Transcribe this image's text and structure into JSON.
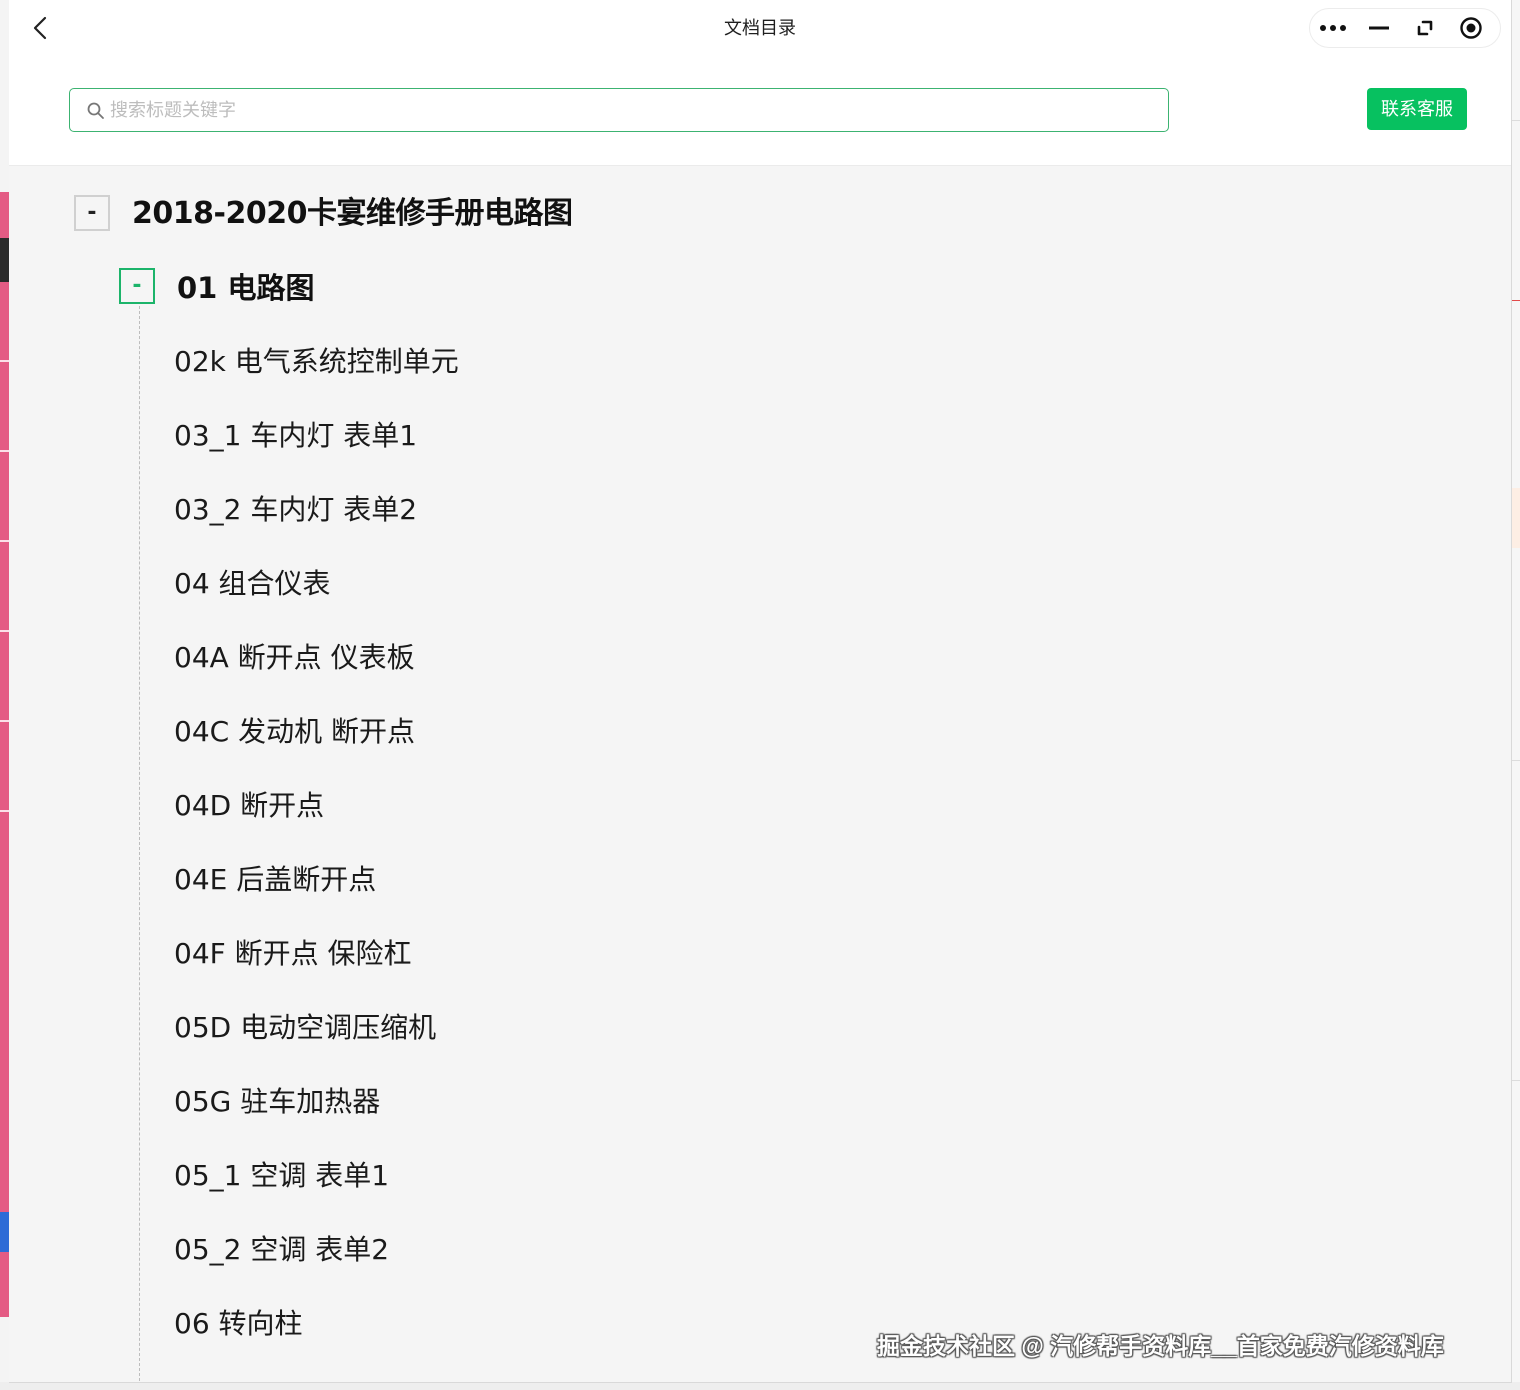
{
  "window": {
    "title": "文档目录"
  },
  "search": {
    "placeholder": "搜索标题关键字",
    "value": ""
  },
  "actions": {
    "contact_label": "联系客服"
  },
  "tree": {
    "root": {
      "toggle": "-",
      "label": "2018-2020卡宴维修手册电路图"
    },
    "section": {
      "toggle": "-",
      "label": "01 电路图"
    },
    "items": [
      "02k 电气系统控制单元",
      "03_1 车内灯 表单1",
      "03_2 车内灯 表单2",
      "04 组合仪表",
      "04A 断开点 仪表板",
      "04C 发动机 断开点",
      "04D 断开点",
      "04E 后盖断开点",
      "04F 断开点 保险杠",
      "05D 电动空调压缩机",
      "05G 驻车加热器",
      "05_1 空调 表单1",
      "05_2 空调 表单2",
      "06 转向柱"
    ]
  },
  "watermark": "掘金技术社区 @ 汽修帮手资料库__首家免费汽修资料库",
  "colors": {
    "accent": "#07c160",
    "search_border": "#3cb371",
    "section_toggle": "#1cb46a",
    "background": "#f5f5f5"
  },
  "icons": [
    "back-chevron-icon",
    "more-dots-icon",
    "minimize-icon",
    "restore-icon",
    "close-circle-icon",
    "search-icon"
  ]
}
